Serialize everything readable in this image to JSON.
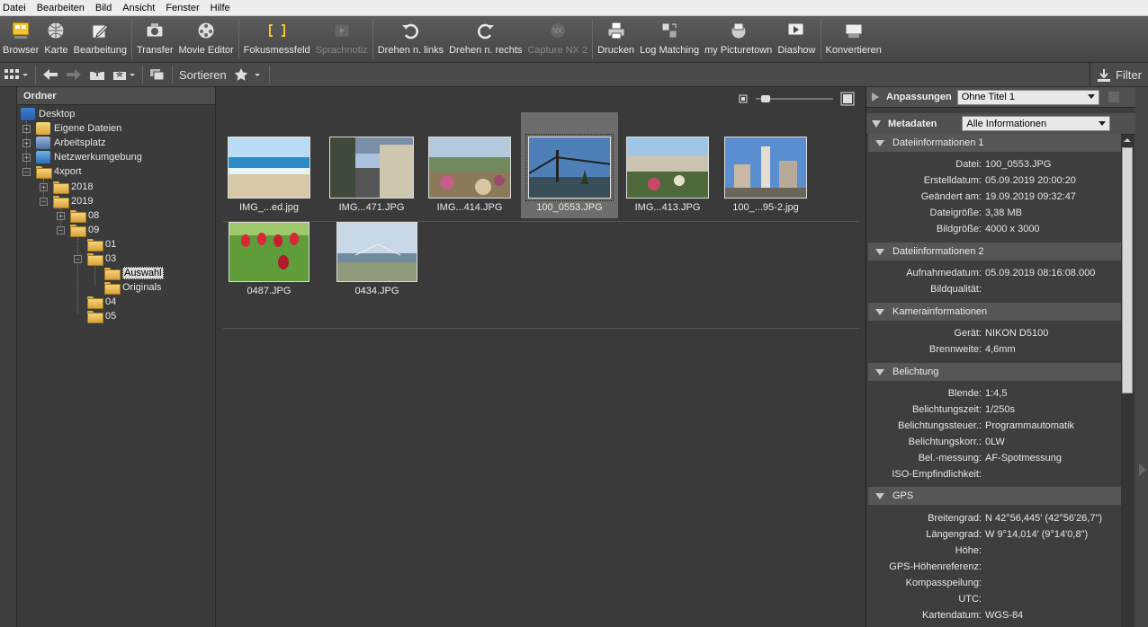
{
  "menu": [
    "Datei",
    "Bearbeiten",
    "Bild",
    "Ansicht",
    "Fenster",
    "Hilfe"
  ],
  "toolbar": {
    "browser": "Browser",
    "karte": "Karte",
    "bearbeitung": "Bearbeitung",
    "transfer": "Transfer",
    "movie_editor": "Movie Editor",
    "fokusmessfeld": "Fokusmessfeld",
    "sprachnotiz": "Sprachnotiz",
    "drehen_links": "Drehen n. links",
    "drehen_rechts": "Drehen n. rechts",
    "capture_nx": "Capture NX 2",
    "drucken": "Drucken",
    "log_matching": "Log Matching",
    "my_picturetown": "my Picturetown",
    "diashow": "Diashow",
    "konvertieren": "Konvertieren"
  },
  "toolbar2": {
    "sort_label": "Sortieren",
    "filter_label": "Filter"
  },
  "left": {
    "header": "Ordner",
    "tree": [
      "Desktop",
      "Eigene Dateien",
      "Arbeitsplatz",
      "Netzwerkumgebung",
      "4xport",
      "2018",
      "2019",
      "08",
      "09",
      "01",
      "03",
      "Auswahl",
      "Originals",
      "04",
      "05"
    ]
  },
  "thumbnails": [
    {
      "caption": "IMG_...ed.jpg"
    },
    {
      "caption": "IMG...471.JPG"
    },
    {
      "caption": "IMG...414.JPG"
    },
    {
      "caption": "100_0553.JPG"
    },
    {
      "caption": "IMG...413.JPG"
    },
    {
      "caption": "100_...95-2.jpg"
    },
    {
      "caption": "0487.JPG"
    },
    {
      "caption": "0434.JPG"
    }
  ],
  "right": {
    "anpassungen_label": "Anpassungen",
    "anpassungen_value": "Ohne Titel 1",
    "metadaten_label": "Metadaten",
    "metadaten_value": "Alle Informationen",
    "sections": [
      {
        "title": "Dateiinformationen 1",
        "rows": [
          [
            "Datei:",
            "100_0553.JPG"
          ],
          [
            "Erstelldatum:",
            "05.09.2019 20:00:20"
          ],
          [
            "Geändert am:",
            "19.09.2019 09:32:47"
          ],
          [
            "Dateigröße:",
            "3,38 MB"
          ],
          [
            "Bildgröße:",
            "4000 x 3000"
          ]
        ]
      },
      {
        "title": "Dateiinformationen 2",
        "rows": [
          [
            "Aufnahmedatum:",
            "05.09.2019 08:16:08.000"
          ],
          [
            "Bildqualität:",
            ""
          ]
        ]
      },
      {
        "title": "Kamerainformationen",
        "rows": [
          [
            "Gerät:",
            "NIKON  D5100"
          ],
          [
            "Brennweite:",
            "4,6mm"
          ]
        ]
      },
      {
        "title": "Belichtung",
        "rows": [
          [
            "Blende:",
            "1:4,5"
          ],
          [
            "Belichtungszeit:",
            "1/250s"
          ],
          [
            "Belichtungssteuer.:",
            "Programmautomatik"
          ],
          [
            "Belichtungskorr.:",
            "0LW"
          ],
          [
            "Bel.-messung:",
            "AF-Spotmessung"
          ],
          [
            "ISO-Empfindlichkeit:",
            ""
          ]
        ]
      },
      {
        "title": "GPS",
        "rows": [
          [
            "Breitengrad:",
            "N 42°56,445' (42°56'26,7\")"
          ],
          [
            "Längengrad:",
            "W 9°14,014' (9°14'0,8\")"
          ],
          [
            "Höhe:",
            ""
          ],
          [
            "GPS-Höhenreferenz:",
            ""
          ],
          [
            "Kompasspeilung:",
            ""
          ],
          [
            "UTC:",
            ""
          ],
          [
            "Kartendatum:",
            "WGS-84"
          ]
        ]
      }
    ]
  }
}
